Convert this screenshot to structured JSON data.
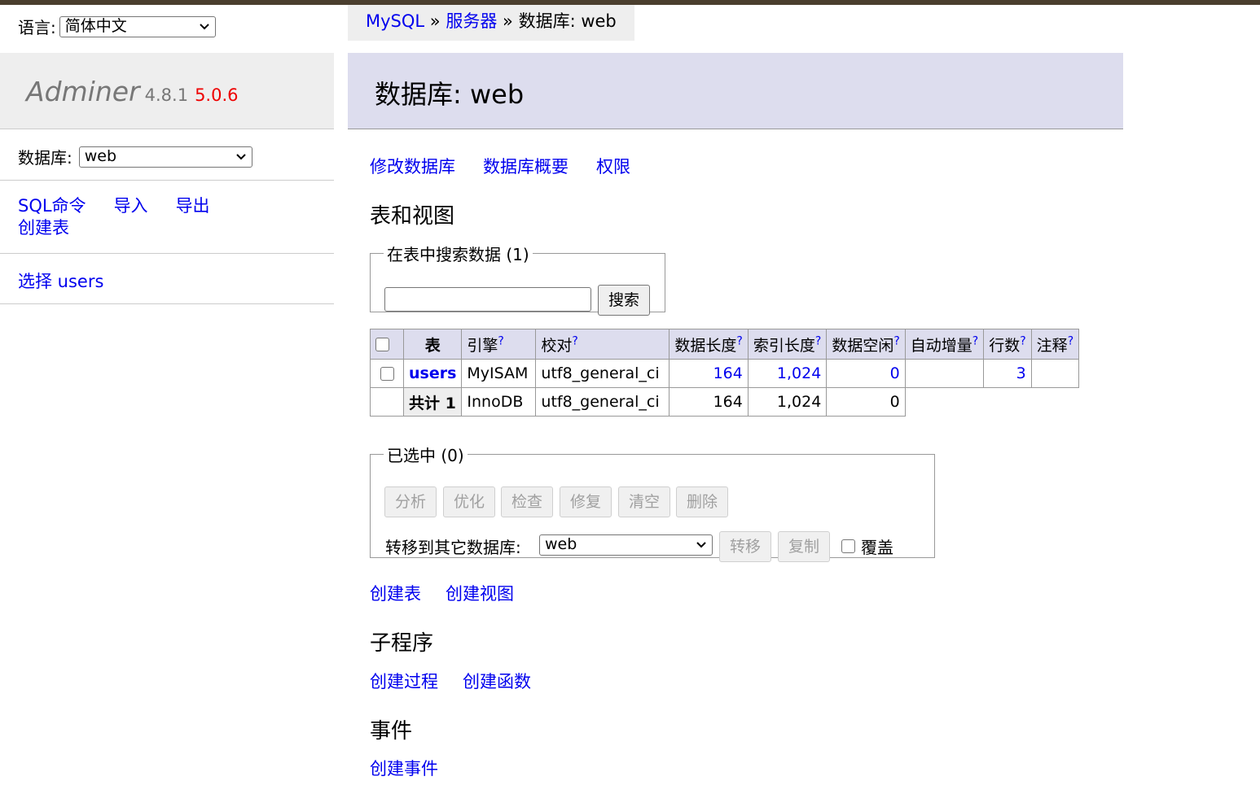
{
  "sidebar": {
    "lang_label": "语言:",
    "lang_value": "简体中文",
    "brand_name": "Adminer",
    "brand_version": "4.8.1",
    "brand_new_version": "5.0.6",
    "db_label": "数据库:",
    "db_value": "web",
    "links": [
      "SQL命令",
      "导入",
      "导出",
      "创建表"
    ],
    "select_link": "选择 users"
  },
  "breadcrumb": {
    "mysql": "MySQL",
    "sep1": "»",
    "server": "服务器",
    "sep2": "»",
    "current": "数据库: web"
  },
  "header": {
    "title": "数据库: web"
  },
  "db_links": [
    "修改数据库",
    "数据库概要",
    "权限"
  ],
  "tables_section": {
    "heading": "表和视图",
    "search_legend": "在表中搜索数据 (1)",
    "search_button": "搜索",
    "columns": [
      "表",
      "引擎",
      "校对",
      "数据长度",
      "索引长度",
      "数据空闲",
      "自动增量",
      "行数",
      "注释"
    ],
    "help_mark": "?",
    "rows": [
      {
        "name": "users",
        "engine": "MyISAM",
        "collation": "utf8_general_ci",
        "data_length": "164",
        "index_length": "1,024",
        "data_free": "0",
        "auto_increment": "",
        "rows": "3",
        "comment": ""
      }
    ],
    "total": {
      "label": "共计 1",
      "engine": "InnoDB",
      "collation": "utf8_general_ci",
      "data_length": "164",
      "index_length": "1,024",
      "data_free": "0"
    }
  },
  "selected": {
    "legend": "已选中 (0)",
    "buttons": [
      "分析",
      "优化",
      "检查",
      "修复",
      "清空",
      "删除"
    ],
    "move_label": "转移到其它数据库:",
    "move_db": "web",
    "move_button": "转移",
    "copy_button": "复制",
    "overwrite_label": "覆盖"
  },
  "create_links": [
    "创建表",
    "创建视图"
  ],
  "routines": {
    "heading": "子程序",
    "links": [
      "创建过程",
      "创建函数"
    ]
  },
  "events": {
    "heading": "事件",
    "links": [
      "创建事件"
    ]
  },
  "colors": {
    "link": "#0000ee",
    "header_bg": "#ddddee",
    "new_version": "#ee0000",
    "brand": "#777777"
  }
}
